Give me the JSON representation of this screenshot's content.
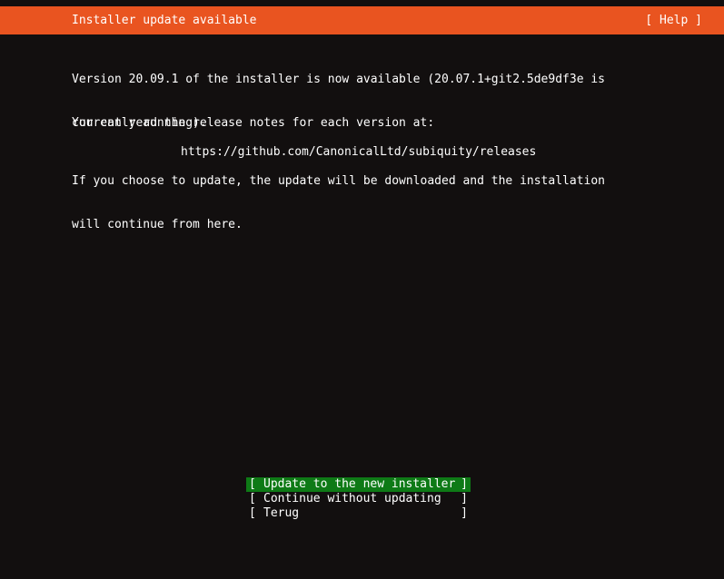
{
  "window": {
    "app": "subiquity-installer-tui",
    "background_color": "#120f0f",
    "foreground_color": "#ffffff"
  },
  "header": {
    "title": "Installer update available",
    "help_label": "[ Help ]",
    "background_color": "#e95420",
    "text_color": "#ffffff"
  },
  "body": {
    "paragraphs": {
      "version": {
        "line1": "Version 20.09.1 of the installer is now available (20.07.1+git2.5de9df3e is",
        "line2": "currently running)."
      },
      "release_notes": {
        "line1": "You can read the release notes for each version at:"
      },
      "url": {
        "line1": "https://github.com/CanonicalLtd/subiquity/releases"
      },
      "update_info": {
        "line1": "If you choose to update, the update will be downloaded and the installation",
        "line2": "will continue from here."
      }
    }
  },
  "buttons": {
    "selected_index": 0,
    "selected_background_color": "#0e7a16",
    "bracket_left": "[",
    "bracket_right": "]",
    "items": [
      {
        "label": "Update to the new installer",
        "selected": true
      },
      {
        "label": "Continue without updating",
        "selected": false
      },
      {
        "label": "Terug",
        "selected": false
      }
    ]
  }
}
